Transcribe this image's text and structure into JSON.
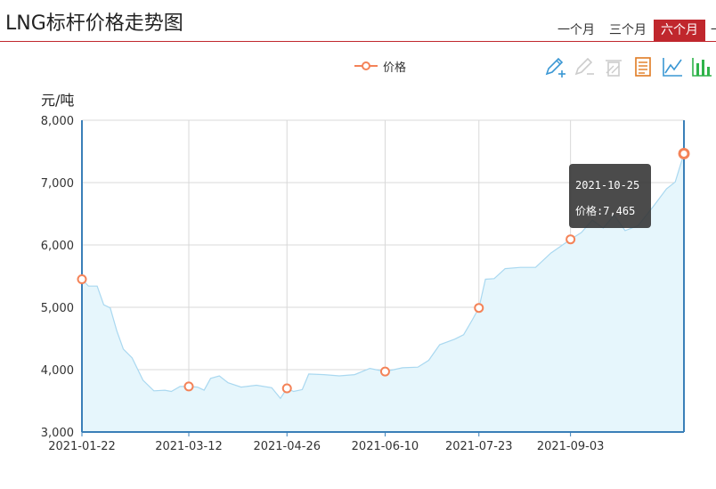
{
  "header": {
    "title": "LNG标杆价格走势图",
    "tabs": [
      "一个月",
      "三个月",
      "六个月",
      "一"
    ],
    "active_tab": 2,
    "accent_color": "#c0272d"
  },
  "legend": {
    "label": "价格",
    "color": "#f48358"
  },
  "toolbox": [
    {
      "name": "mark-line-icon",
      "color": "#3a97d4"
    },
    {
      "name": "erase-mark-icon",
      "color": "#cccccc"
    },
    {
      "name": "clear-mark-icon",
      "color": "#cccccc"
    },
    {
      "name": "data-view-icon",
      "color": "#e07b22"
    },
    {
      "name": "line-chart-icon",
      "color": "#3a97d4"
    },
    {
      "name": "bar-chart-icon",
      "color": "#2fb34a"
    }
  ],
  "tooltip": {
    "date": "2021-10-25",
    "label": "价格:7,465"
  },
  "chart_data": {
    "type": "area",
    "ylabel": "元/吨",
    "ylim": [
      3000,
      8000
    ],
    "yticks": [
      3000,
      4000,
      5000,
      6000,
      7000,
      8000
    ],
    "ytick_labels": [
      "3,000",
      "4,000",
      "5,000",
      "6,000",
      "7,000",
      "8,000"
    ],
    "xlim": [
      "2021-01-22",
      "2021-10-25"
    ],
    "xticks": [
      "2021-01-22",
      "2021-03-12",
      "2021-04-26",
      "2021-06-10",
      "2021-07-23",
      "2021-09-03"
    ],
    "grid": true,
    "line_color": "#a9d8f0",
    "area_color": "#e6f6fc",
    "marker_color": "#f48358",
    "series": [
      {
        "name": "价格",
        "points": [
          [
            "2021-01-22",
            5450
          ],
          [
            "2021-01-25",
            5340
          ],
          [
            "2021-01-29",
            5340
          ],
          [
            "2021-02-01",
            5040
          ],
          [
            "2021-02-04",
            4990
          ],
          [
            "2021-02-07",
            4620
          ],
          [
            "2021-02-10",
            4330
          ],
          [
            "2021-02-14",
            4190
          ],
          [
            "2021-02-19",
            3830
          ],
          [
            "2021-02-24",
            3660
          ],
          [
            "2021-03-01",
            3670
          ],
          [
            "2021-03-04",
            3650
          ],
          [
            "2021-03-08",
            3730
          ],
          [
            "2021-03-12",
            3730
          ],
          [
            "2021-03-16",
            3720
          ],
          [
            "2021-03-19",
            3670
          ],
          [
            "2021-03-22",
            3860
          ],
          [
            "2021-03-26",
            3900
          ],
          [
            "2021-03-30",
            3790
          ],
          [
            "2021-04-05",
            3720
          ],
          [
            "2021-04-12",
            3750
          ],
          [
            "2021-04-19",
            3710
          ],
          [
            "2021-04-23",
            3540
          ],
          [
            "2021-04-26",
            3700
          ],
          [
            "2021-04-29",
            3650
          ],
          [
            "2021-05-03",
            3680
          ],
          [
            "2021-05-06",
            3930
          ],
          [
            "2021-05-13",
            3920
          ],
          [
            "2021-05-20",
            3900
          ],
          [
            "2021-05-27",
            3920
          ],
          [
            "2021-06-03",
            4020
          ],
          [
            "2021-06-10",
            3970
          ],
          [
            "2021-06-18",
            4030
          ],
          [
            "2021-06-25",
            4040
          ],
          [
            "2021-06-30",
            4150
          ],
          [
            "2021-07-05",
            4400
          ],
          [
            "2021-07-12",
            4490
          ],
          [
            "2021-07-16",
            4560
          ],
          [
            "2021-07-20",
            4800
          ],
          [
            "2021-07-23",
            4990
          ],
          [
            "2021-07-26",
            5450
          ],
          [
            "2021-07-30",
            5460
          ],
          [
            "2021-08-04",
            5620
          ],
          [
            "2021-08-11",
            5640
          ],
          [
            "2021-08-18",
            5640
          ],
          [
            "2021-08-25",
            5870
          ],
          [
            "2021-09-01",
            6040
          ],
          [
            "2021-09-03",
            6090
          ],
          [
            "2021-09-08",
            6200
          ],
          [
            "2021-09-13",
            6400
          ],
          [
            "2021-09-18",
            6270
          ],
          [
            "2021-09-23",
            6480
          ],
          [
            "2021-09-28",
            6230
          ],
          [
            "2021-10-04",
            6310
          ],
          [
            "2021-10-11",
            6620
          ],
          [
            "2021-10-17",
            6900
          ],
          [
            "2021-10-21",
            7010
          ],
          [
            "2021-10-25",
            7465
          ]
        ],
        "markers": [
          "2021-01-22",
          "2021-03-12",
          "2021-04-26",
          "2021-06-10",
          "2021-07-23",
          "2021-09-03",
          "2021-10-25"
        ]
      }
    ]
  }
}
